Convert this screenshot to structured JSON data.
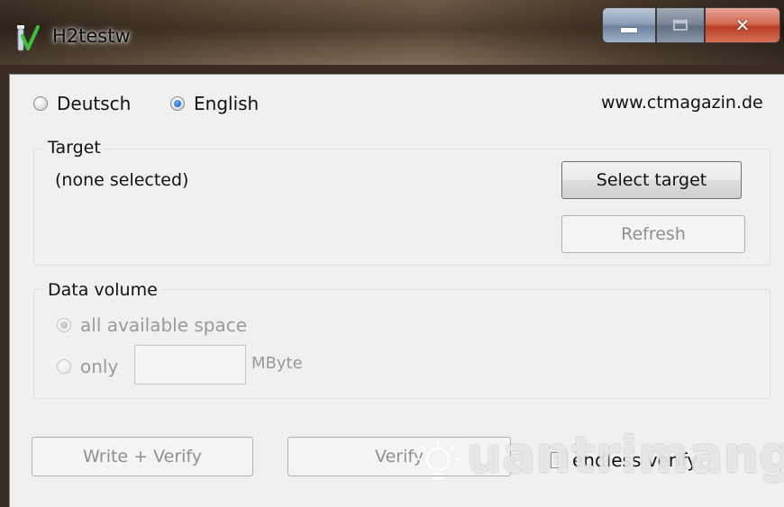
{
  "window": {
    "title": "H2testw",
    "accent_close": "#c8432b"
  },
  "language": {
    "options": [
      {
        "label": "Deutsch",
        "checked": false
      },
      {
        "label": "English",
        "checked": true
      }
    ],
    "website": "www.ctmagazin.de"
  },
  "target": {
    "group_label": "Target",
    "status": "(none selected)",
    "select_button": "Select target",
    "refresh_button": "Refresh"
  },
  "data_volume": {
    "group_label": "Data volume",
    "all_space_label": "all available space",
    "only_label": "only",
    "mbyte_value": "",
    "unit": "MByte"
  },
  "actions": {
    "write_verify_button": "Write + Verify",
    "verify_button": "Verify",
    "endless_verify_label": "endless verify"
  },
  "watermark": {
    "text": "uantrimang"
  }
}
